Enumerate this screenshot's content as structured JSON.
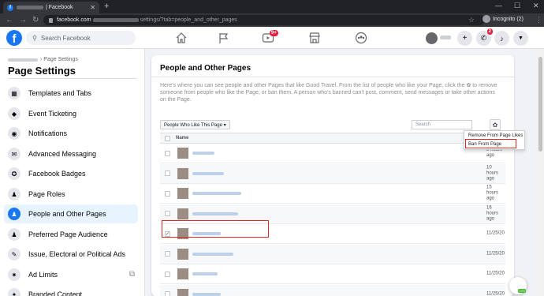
{
  "browser": {
    "tab_title": "| Facebook",
    "url_host": "facebook.com",
    "url_path": "settings/?tab=people_and_other_pages",
    "profile_label": "Incognito (2)"
  },
  "fb_header": {
    "search_placeholder": "Search Facebook",
    "watch_badge": "9+",
    "messenger_badge": "2"
  },
  "sidebar": {
    "breadcrumb_suffix": "› Page Settings",
    "title": "Page Settings",
    "items": [
      {
        "label": "Templates and Tabs",
        "icon": "grid-icon",
        "glyph": "▦"
      },
      {
        "label": "Event Ticketing",
        "icon": "ticket-icon",
        "glyph": "◆"
      },
      {
        "label": "Notifications",
        "icon": "globe-icon",
        "glyph": "◉"
      },
      {
        "label": "Advanced Messaging",
        "icon": "messenger-icon",
        "glyph": "✉"
      },
      {
        "label": "Facebook Badges",
        "icon": "badge-icon",
        "glyph": "✪"
      },
      {
        "label": "Page Roles",
        "icon": "person-icon",
        "glyph": "♟"
      },
      {
        "label": "People and Other Pages",
        "icon": "people-icon",
        "glyph": "♟"
      },
      {
        "label": "Preferred Page Audience",
        "icon": "audience-icon",
        "glyph": "♟"
      },
      {
        "label": "Issue, Electoral or Political Ads",
        "icon": "wrench-icon",
        "glyph": "✎"
      },
      {
        "label": "Ad Limits",
        "icon": "gear-icon",
        "glyph": "✷"
      },
      {
        "label": "Branded Content",
        "icon": "handshake-icon",
        "glyph": "✦"
      }
    ],
    "active_index": 6
  },
  "main": {
    "title": "People and Other Pages",
    "description": "Here's where you can see people and other Pages that like Good Travel. From the list of people who like your Page, click the ✿ to remove someone from people who like the Page, or ban them. A person who's banned can't post, comment, send messages or take other actions on the Page.",
    "filter_button": "People Who Like This Page ▾",
    "search_placeholder": "Search",
    "column_name": "Name",
    "rows": [
      {
        "time": "8 hours ago",
        "checked": false,
        "blur_w": 28
      },
      {
        "time": "10 hours ago",
        "checked": false,
        "blur_w": 40
      },
      {
        "time": "15 hours ago",
        "checked": false,
        "blur_w": 62
      },
      {
        "time": "16 hours ago",
        "checked": false,
        "blur_w": 58
      },
      {
        "time": "11/25/20",
        "checked": true,
        "blur_w": 36
      },
      {
        "time": "11/25/20",
        "checked": false,
        "blur_w": 52
      },
      {
        "time": "11/25/20",
        "checked": false,
        "blur_w": 32
      },
      {
        "time": "11/25/20",
        "checked": false,
        "blur_w": 36
      }
    ]
  },
  "dropdown": {
    "remove_label": "Remove From Page Likes",
    "ban_label": "Ban From Page"
  },
  "floating": {
    "percent": "72%"
  }
}
